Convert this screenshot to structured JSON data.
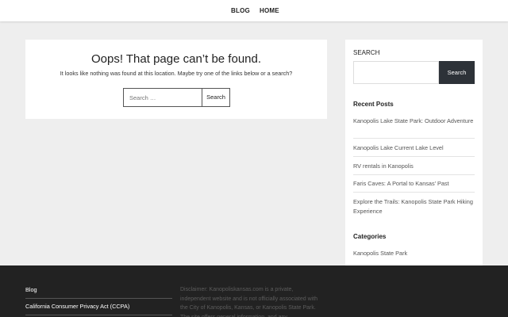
{
  "nav": {
    "items": [
      {
        "label": "BLOG"
      },
      {
        "label": "HOME"
      }
    ]
  },
  "error": {
    "title": "Oops! That page can’t be found.",
    "message": "It looks like nothing was found at this location. Maybe try one of the links below or a search?",
    "search_placeholder": "Search …",
    "search_button": "Search"
  },
  "sidebar": {
    "search_heading": "SEARCH",
    "search_button": "Search",
    "recent_heading": "Recent Posts",
    "recent_posts": [
      "Kanopolis Lake State Park: Outdoor Adventure",
      "Kanopolis Lake Current Lake Level",
      "RV rentals in Kanopolis",
      "Faris Caves: A Portal to Kansas’ Past",
      "Explore the Trails: Kanopolis State Park Hiking Experience"
    ],
    "categories_heading": "Categories",
    "categories": [
      "Kanopolis State Park"
    ]
  },
  "footer": {
    "links": [
      "Blog",
      "California Consumer Privacy Act (CCPA)"
    ],
    "disclaimer": "Disclaimer: Kanopoliskansas.com is a private, independent website and is not officially associated with the City of Kanopolis, Kansas, or Kanopolis State Park. The site offers general information, and any",
    "colors": {
      "background": "#222222",
      "text": "#ffffff",
      "muted": "#5c5c5c"
    }
  },
  "colors": {
    "page_bg": "#eeeeee",
    "card_bg": "#ffffff",
    "button_dark": "#2d3238"
  }
}
